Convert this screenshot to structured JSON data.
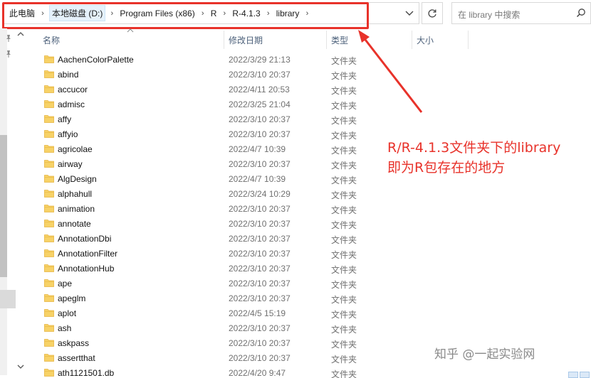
{
  "address": {
    "breadcrumbs": [
      "此电脑",
      "本地磁盘 (D:)",
      "Program Files (x86)",
      "R",
      "R-4.1.3",
      "library"
    ],
    "separator": "›",
    "dropdown_icon": "chevron-down-icon",
    "refresh_icon": "refresh-icon"
  },
  "search": {
    "placeholder": "在 library 中搜索",
    "icon": "search-icon"
  },
  "columns": {
    "name": "名称",
    "date": "修改日期",
    "type": "类型",
    "size": "大小"
  },
  "files": [
    {
      "name": "AachenColorPalette",
      "date": "2022/3/29 21:13",
      "type": "文件夹"
    },
    {
      "name": "abind",
      "date": "2022/3/10 20:37",
      "type": "文件夹"
    },
    {
      "name": "accucor",
      "date": "2022/4/11 20:53",
      "type": "文件夹"
    },
    {
      "name": "admisc",
      "date": "2022/3/25 21:04",
      "type": "文件夹"
    },
    {
      "name": "affy",
      "date": "2022/3/10 20:37",
      "type": "文件夹"
    },
    {
      "name": "affyio",
      "date": "2022/3/10 20:37",
      "type": "文件夹"
    },
    {
      "name": "agricolae",
      "date": "2022/4/7 10:39",
      "type": "文件夹"
    },
    {
      "name": "airway",
      "date": "2022/3/10 20:37",
      "type": "文件夹"
    },
    {
      "name": "AlgDesign",
      "date": "2022/4/7 10:39",
      "type": "文件夹"
    },
    {
      "name": "alphahull",
      "date": "2022/3/24 10:29",
      "type": "文件夹"
    },
    {
      "name": "animation",
      "date": "2022/3/10 20:37",
      "type": "文件夹"
    },
    {
      "name": "annotate",
      "date": "2022/3/10 20:37",
      "type": "文件夹"
    },
    {
      "name": "AnnotationDbi",
      "date": "2022/3/10 20:37",
      "type": "文件夹"
    },
    {
      "name": "AnnotationFilter",
      "date": "2022/3/10 20:37",
      "type": "文件夹"
    },
    {
      "name": "AnnotationHub",
      "date": "2022/3/10 20:37",
      "type": "文件夹"
    },
    {
      "name": "ape",
      "date": "2022/3/10 20:37",
      "type": "文件夹"
    },
    {
      "name": "apeglm",
      "date": "2022/3/10 20:37",
      "type": "文件夹"
    },
    {
      "name": "aplot",
      "date": "2022/4/5 15:19",
      "type": "文件夹"
    },
    {
      "name": "ash",
      "date": "2022/3/10 20:37",
      "type": "文件夹"
    },
    {
      "name": "askpass",
      "date": "2022/3/10 20:37",
      "type": "文件夹"
    },
    {
      "name": "assertthat",
      "date": "2022/3/10 20:37",
      "type": "文件夹"
    },
    {
      "name": "ath1121501.db",
      "date": "2022/4/20 9:47",
      "type": "文件夹"
    }
  ],
  "annotation": {
    "line1": "R/R-4.1.3文件夹下的library",
    "line2": "即为R包存在的地方",
    "color": "#e8322a"
  },
  "watermark": "知乎 @一起实验网",
  "colors": {
    "folder": "#f7d267",
    "folder_dark": "#e6b440",
    "header_text": "#4c607a",
    "secondary_text": "#707070"
  }
}
